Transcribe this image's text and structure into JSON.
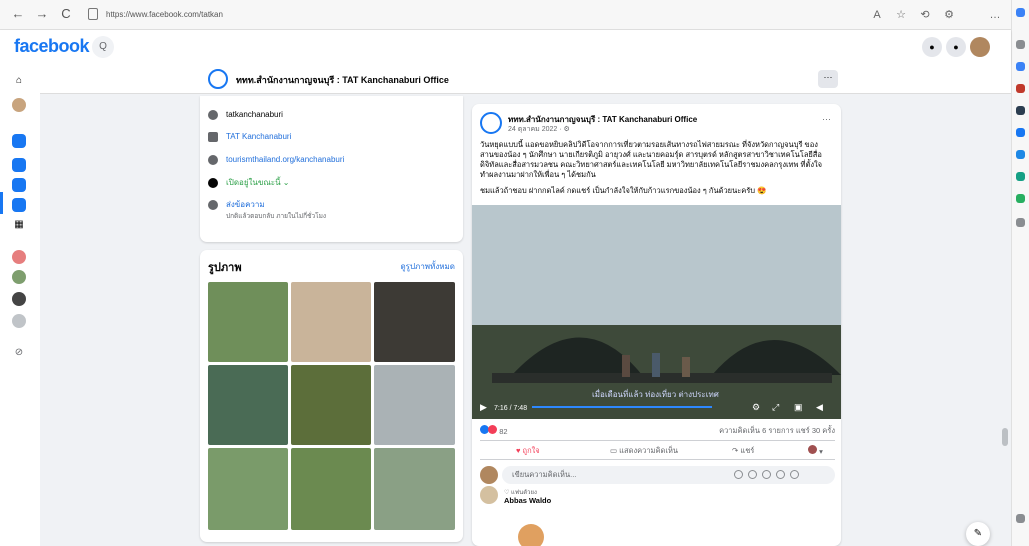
{
  "browser": {
    "url": "https://www.facebook.com/tatkan",
    "back": "←",
    "forward": "→",
    "reload": "C",
    "toolbar_icons": [
      "A",
      "☆",
      "⟲",
      "⚙",
      "…"
    ]
  },
  "header": {
    "logo": "facebook",
    "search_glyph": "Q"
  },
  "page_bar": {
    "name": "ททท.สำนักงานกาญจนบุรี : TAT Kanchanaburi Office",
    "more": "···"
  },
  "intro": {
    "items": [
      {
        "label": "tatkanchanaburi",
        "kind": "plain"
      },
      {
        "label": "TAT Kanchanaburi",
        "kind": "link"
      },
      {
        "label": "tourismthailand.org/kanchanaburi",
        "kind": "link"
      },
      {
        "label": "เปิดอยู่ในขณะนี้ ⌄",
        "kind": "green"
      },
      {
        "label": "ส่งข้อความ",
        "kind": "link"
      }
    ],
    "message_sub": "ปกติแล้วตอบกลับ ภายในไม่กี่ชั่วโมง"
  },
  "photos": {
    "title": "รูปภาพ",
    "see_all": "ดูรูปภาพทั้งหมด",
    "colors": [
      "#6f8f5a",
      "#c9b49a",
      "#3d3a35",
      "#4a6b55",
      "#5c6e3a",
      "#aab2b5",
      "#7a9b6a",
      "#6b8a50",
      "#8aa085"
    ]
  },
  "post": {
    "page_name": "ททท.สำนักงานกาญจนบุรี : TAT Kanchanaburi Office",
    "date": "24 ตุลาคม 2022 · ⚙",
    "more": "···",
    "text": "วันหยุดแบบนี้ แอดขอหยิบคลิปวิดีโอจากการเที่ยวตามรอยเส้นทางรถไฟสายมรณะ ที่จังหวัดกาญจนบุรี ของสานของน้อง ๆ นักศึกษา นายเกียรติภูมิ อายุวงศ์ และนายคอมรุ์ด สารบุตรด์ หลักสูตรสาขาวิชาเทคโนโลยีสื่อดิจิทัลและสื่อสารมวลชน คณะวิทยาศาสตร์และเทคโนโลยี มหาวิทยาลัยเทคโนโลยีราชมงคลกรุงเทพ ที่ตั้งใจทำผลงานมาฝากให้เพื่อน ๆ ได้ชมกัน",
    "text2": "ชมแล้วถ้าชอบ ฝากกดไลค์ กดแชร์ เป็นกำลังใจให้กับก้าวแรกของน้อง ๆ กันด้วยนะครับ 😍",
    "video_time": "7:16 / 7:48",
    "video_caption": "เมื่อเดือนที่แล้ว ท่องเที่ยว ต่างประเทศ",
    "reaction_count": "82",
    "comments_shares": "ความคิดเห็น 6 รายการ  แชร์ 30 ครั้ง",
    "like": "ถูกใจ",
    "comment": "แสดงความคิดเห็น",
    "share": "แชร์",
    "comment_placeholder": "เขียนความคิดเห็น...",
    "commenter_badge": "♡ แฟนตัวยง",
    "commenter_name": "Abbas Waldo"
  }
}
